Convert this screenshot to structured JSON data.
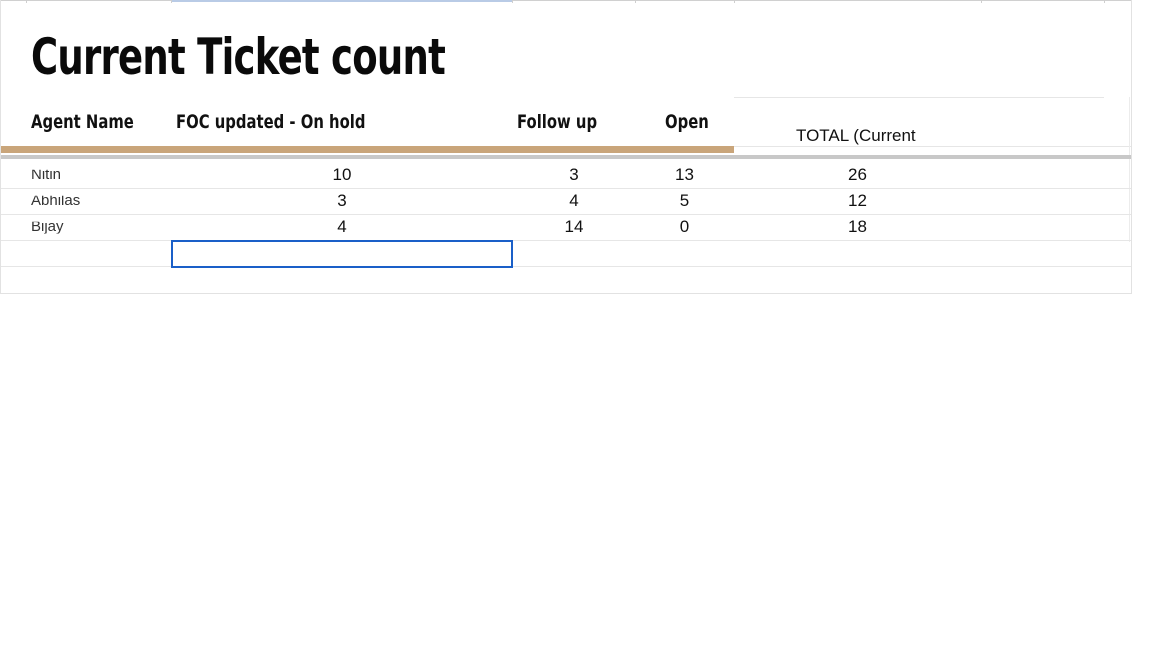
{
  "sheet": {
    "title": "Current Ticket count",
    "headers": {
      "agent_name": "Agent Name",
      "foc_on_hold": "FOC updated - On hold",
      "follow_up": "Follow up",
      "open": "Open",
      "total": "TOTAL (Current"
    },
    "rows": [
      {
        "name": "Nitin",
        "foc": "10",
        "follow": "3",
        "open": "13",
        "total": "26"
      },
      {
        "name": "Abhilas",
        "foc": "3",
        "follow": "4",
        "open": "5",
        "total": "12"
      },
      {
        "name": "Bijay",
        "foc": "4",
        "follow": "14",
        "open": "0",
        "total": "18"
      }
    ],
    "colors": {
      "header_band": "#c9a57a",
      "selection_border": "#1a5fc8"
    }
  }
}
